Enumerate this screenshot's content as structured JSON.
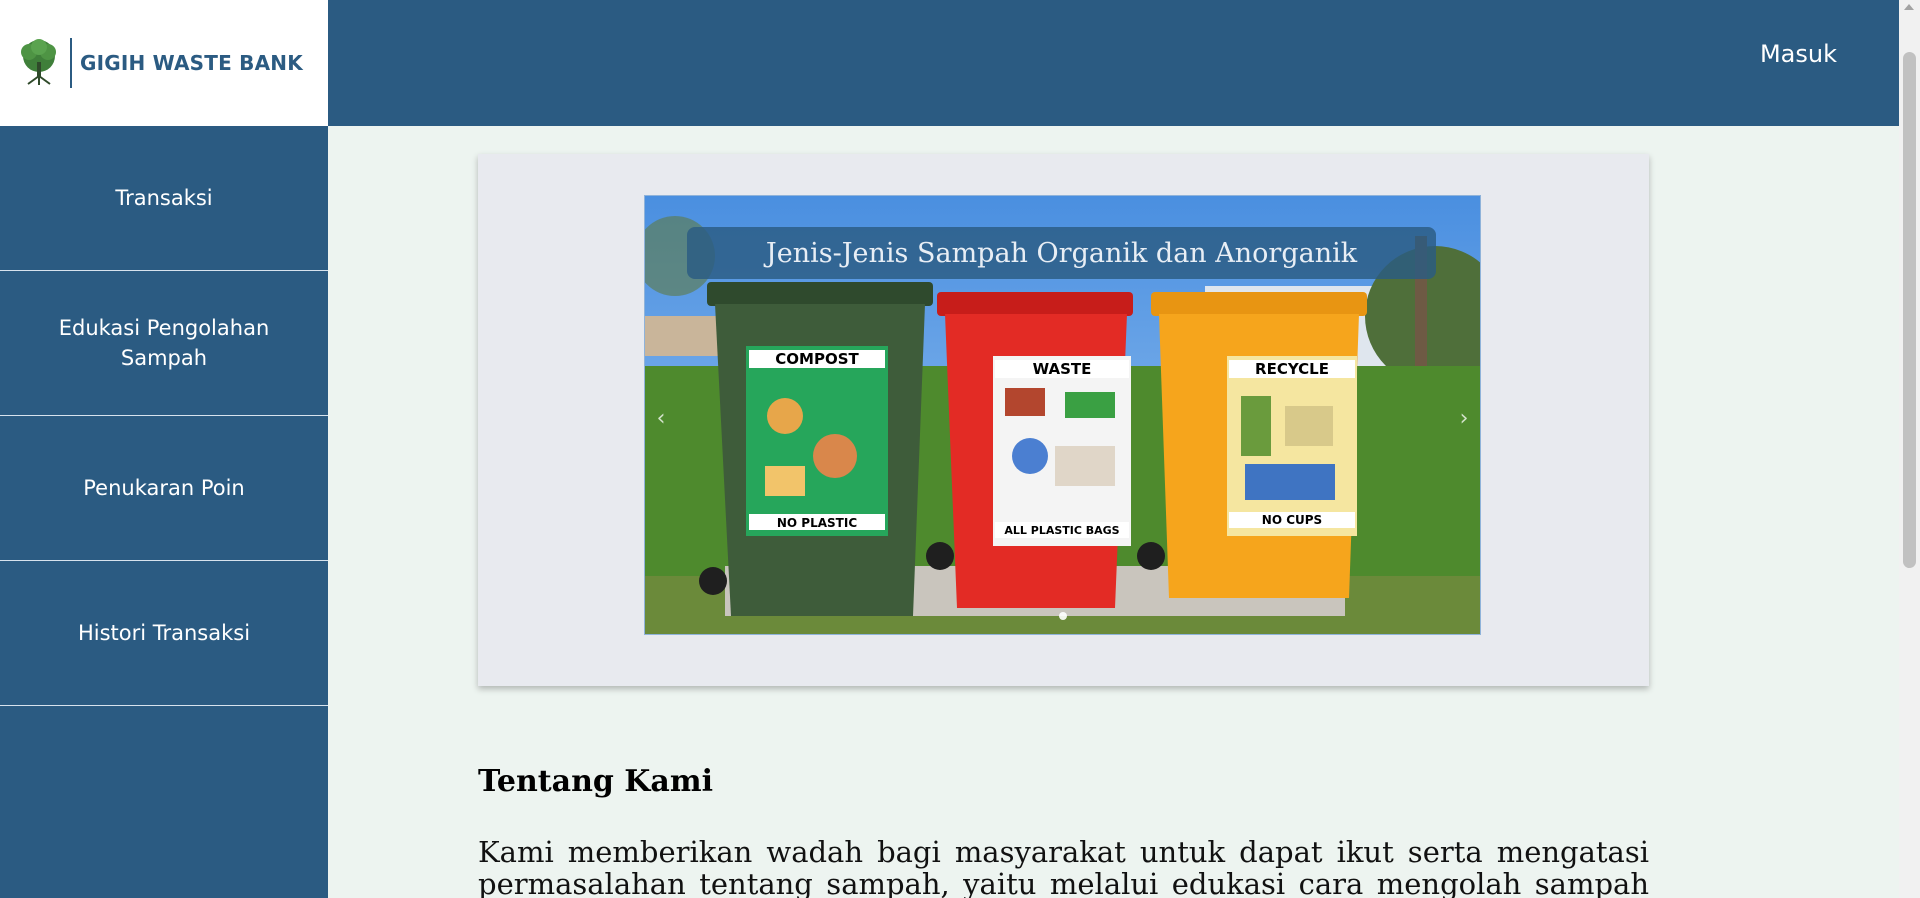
{
  "brand": {
    "name": "GIGIH WASTE BANK",
    "icon": "tree-logo-icon"
  },
  "header": {
    "login_label": "Masuk"
  },
  "sidebar": {
    "items": [
      {
        "label": "Transaksi"
      },
      {
        "label": "Edukasi Pengolahan Sampah"
      },
      {
        "label": "Penukaran Poin"
      },
      {
        "label": "Histori Transaksi"
      }
    ]
  },
  "carousel": {
    "caption": "Jenis-Jenis Sampah Organik dan Anorganik",
    "prev_icon": "chevron-left-icon",
    "next_icon": "chevron-right-icon",
    "bins": [
      {
        "top_label": "COMPOST",
        "bottom_label": "NO PLASTIC",
        "color": "#3e5c3a"
      },
      {
        "top_label": "WASTE",
        "bottom_label": "ALL PLASTIC BAGS",
        "color": "#e32b25"
      },
      {
        "top_label": "RECYCLE",
        "bottom_label": "NO CUPS",
        "color": "#f6a51c"
      }
    ],
    "slide_count": 1,
    "active_slide": 1
  },
  "about": {
    "title": "Tentang Kami",
    "body": "Kami memberikan wadah bagi masyarakat untuk dapat ikut serta mengatasi permasalahan tentang sampah, yaitu melalui edukasi cara mengolah sampah dan"
  },
  "colors": {
    "primary": "#2b5b82",
    "background": "#edf4f0",
    "card": "#e8eaef"
  }
}
